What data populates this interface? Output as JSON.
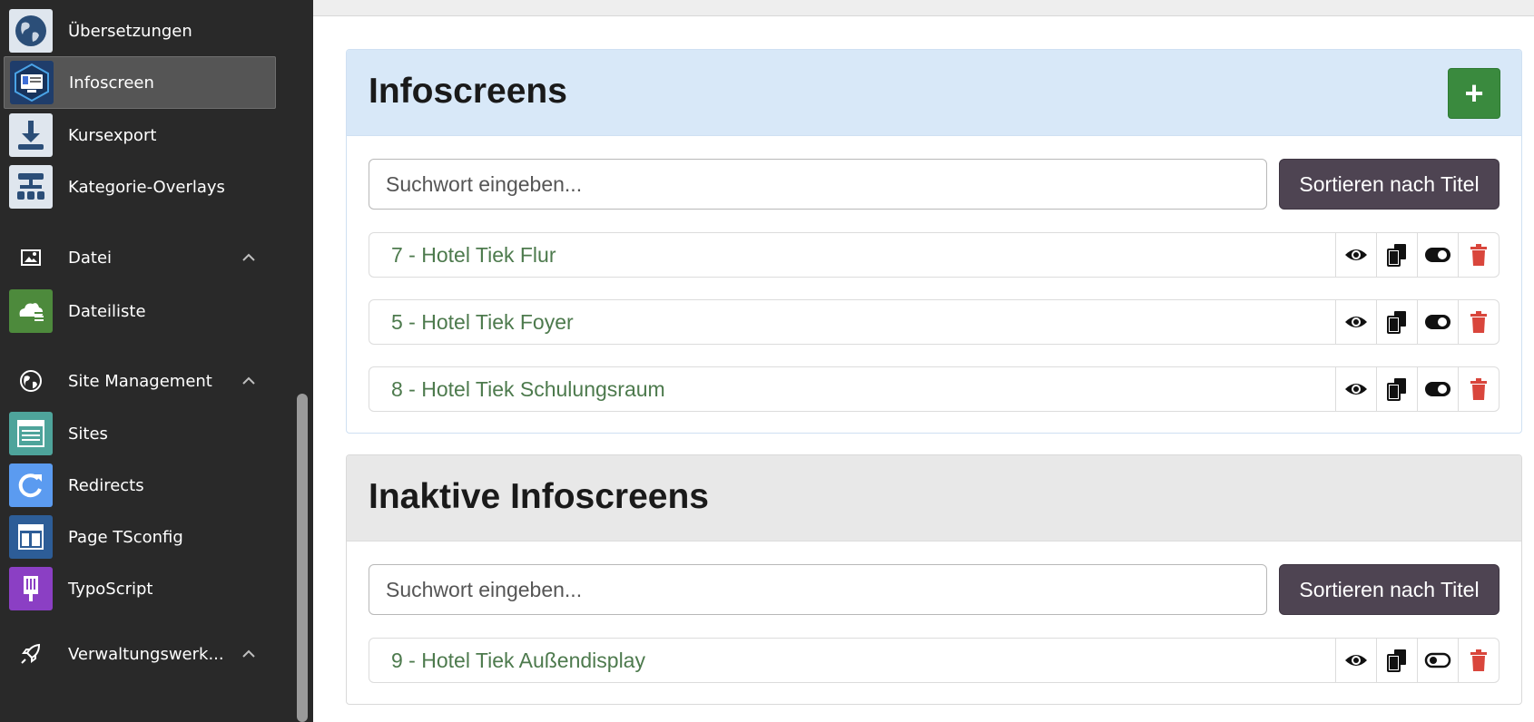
{
  "sidebar": {
    "items": [
      {
        "label": "Übersetzungen",
        "icon": "globe-icon"
      },
      {
        "label": "Infoscreen",
        "icon": "infoscreen-icon",
        "active": true
      },
      {
        "label": "Kursexport",
        "icon": "download-icon"
      },
      {
        "label": "Kategorie-Overlays",
        "icon": "hierarchy-icon"
      }
    ],
    "group_datei": {
      "label": "Datei",
      "icon": "image-icon"
    },
    "datei_items": [
      {
        "label": "Dateiliste",
        "icon": "cloud-icon"
      }
    ],
    "group_site": {
      "label": "Site Management",
      "icon": "globe-icon"
    },
    "site_items": [
      {
        "label": "Sites",
        "icon": "sites-icon"
      },
      {
        "label": "Redirects",
        "icon": "redirect-icon"
      },
      {
        "label": "Page TSconfig",
        "icon": "layout-icon"
      },
      {
        "label": "TypoScript",
        "icon": "typoscript-icon"
      }
    ],
    "group_admin": {
      "label": "Verwaltungswerk...",
      "icon": "rocket-icon"
    }
  },
  "main": {
    "active_panel": {
      "title": "Infoscreens",
      "add_label": "+",
      "search_placeholder": "Suchwort eingeben...",
      "sort_label": "Sortieren nach Titel",
      "rows": [
        {
          "title": "7 - Hotel Tiek Flur",
          "active": true
        },
        {
          "title": "5 - Hotel Tiek Foyer",
          "active": true
        },
        {
          "title": "8 - Hotel Tiek Schulungsraum",
          "active": true
        }
      ]
    },
    "inactive_panel": {
      "title": "Inaktive Infoscreens",
      "search_placeholder": "Suchwort eingeben...",
      "sort_label": "Sortieren nach Titel",
      "rows": [
        {
          "title": "9 - Hotel Tiek Außendisplay",
          "active": false
        }
      ]
    }
  },
  "colors": {
    "sidebar_bg": "#292929",
    "add_green": "#3a8a3e",
    "sort_purple": "#4e4452",
    "delete_red": "#d9463c",
    "row_text_green": "#4d7a4d",
    "panel_head_blue": "#d8e8f8"
  }
}
